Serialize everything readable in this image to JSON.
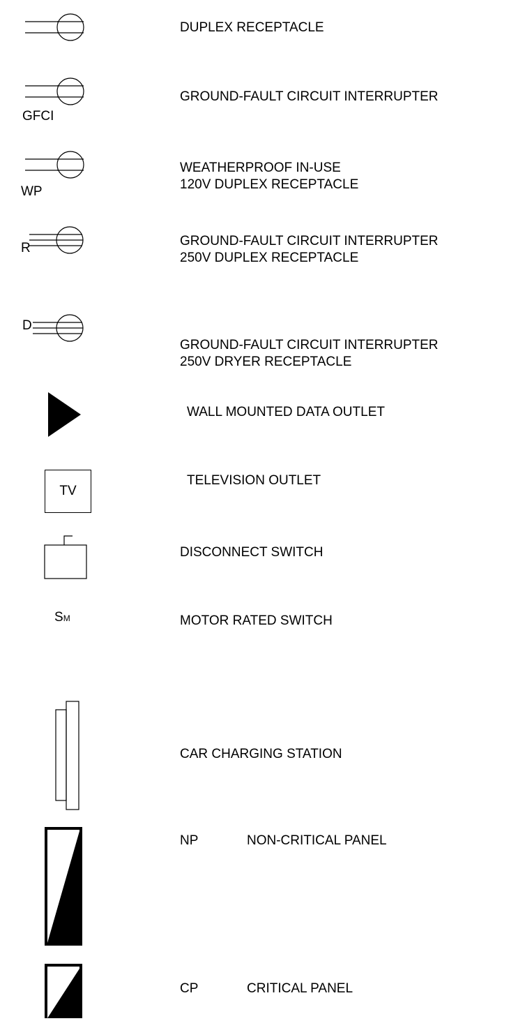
{
  "legend": {
    "items": [
      {
        "id": "duplex",
        "symbol": "duplex-receptacle",
        "lines": [
          "DUPLEX RECEPTACLE"
        ]
      },
      {
        "id": "gfci",
        "symbol": "gfci-receptacle",
        "symbol_label": "GFCI",
        "lines": [
          "GROUND-FAULT CIRCUIT INTERRUPTER"
        ]
      },
      {
        "id": "wp",
        "symbol": "weatherproof-receptacle",
        "symbol_label": "WP",
        "lines": [
          "WEATHERPROOF IN-USE",
          "120V DUPLEX RECEPTACLE"
        ]
      },
      {
        "id": "r250",
        "symbol": "250v-receptacle",
        "symbol_label": "R",
        "lines": [
          "GROUND-FAULT CIRCUIT INTERRUPTER",
          "250V DUPLEX RECEPTACLE"
        ]
      },
      {
        "id": "dryer",
        "symbol": "dryer-receptacle",
        "symbol_label": "D",
        "lines": [
          "GROUND-FAULT CIRCUIT INTERRUPTER",
          "250V DRYER RECEPTACLE"
        ]
      },
      {
        "id": "data",
        "symbol": "triangle",
        "lines": [
          "WALL MOUNTED DATA OUTLET"
        ]
      },
      {
        "id": "tv",
        "symbol": "box",
        "symbol_label": "TV",
        "lines": [
          "TELEVISION OUTLET"
        ]
      },
      {
        "id": "disconnect",
        "symbol": "disconnect-box",
        "lines": [
          "DISCONNECT SWITCH"
        ]
      },
      {
        "id": "motor",
        "symbol": "text",
        "symbol_label": "S",
        "symbol_subscript": "M",
        "lines": [
          "MOTOR RATED SWITCH"
        ]
      },
      {
        "id": "car",
        "symbol": "charging-station",
        "lines": [
          "CAR CHARGING STATION"
        ]
      },
      {
        "id": "np",
        "symbol": "panel",
        "code": "NP",
        "lines": [
          "NON-CRITICAL PANEL"
        ]
      },
      {
        "id": "cp",
        "symbol": "panel",
        "code": "CP",
        "lines": [
          "CRITICAL PANEL"
        ]
      }
    ]
  }
}
